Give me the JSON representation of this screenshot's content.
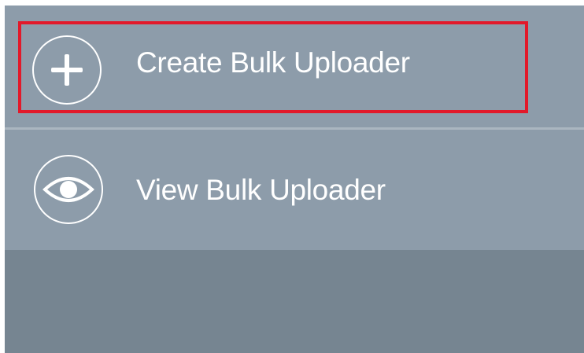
{
  "menu": {
    "items": [
      {
        "label": "Create Bulk Uploader",
        "icon": "plus-circle-icon"
      },
      {
        "label": "View Bulk Uploader",
        "icon": "eye-icon"
      }
    ]
  },
  "colors": {
    "menu_background": "#8d9caa",
    "bottom_background": "#768591",
    "divider": "#aab6c0",
    "text": "#ffffff",
    "highlight": "#e2192a"
  }
}
